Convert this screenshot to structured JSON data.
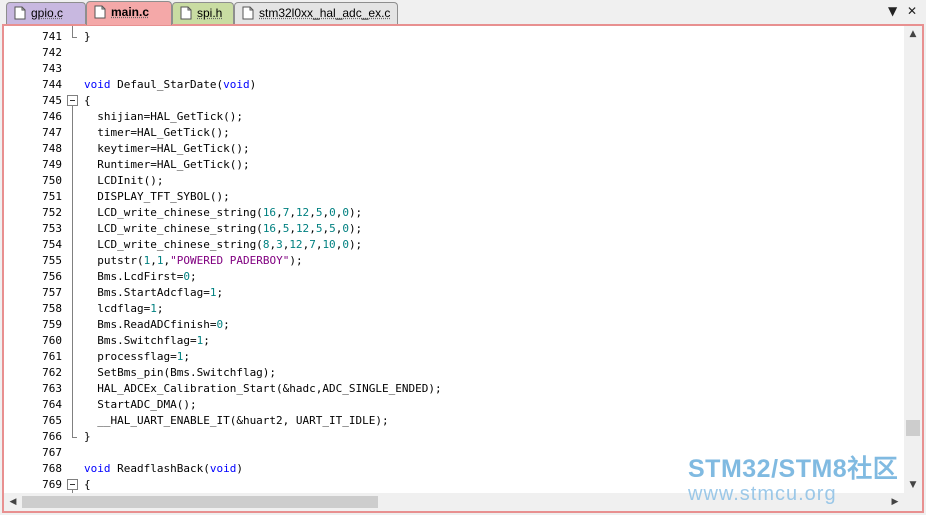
{
  "tabs": [
    {
      "label": "gpio.c",
      "active": false,
      "color": "#c8b8e0"
    },
    {
      "label": "main.c",
      "active": true,
      "color": "#f4a8a8"
    },
    {
      "label": "spi.h",
      "active": false,
      "color": "#c9dca2"
    },
    {
      "label": "stm32l0xx_hal_adc_ex.c",
      "active": false,
      "color": "#e4e4e4"
    }
  ],
  "tab_controls": {
    "dropdown_icon": "▼",
    "close_icon": "✕"
  },
  "scroll_icons": {
    "up": "▲",
    "down": "▼",
    "left": "◀",
    "right": "▶"
  },
  "editor": {
    "lines": [
      {
        "num": "741",
        "tokens": [
          [
            "}",
            "t"
          ]
        ]
      },
      {
        "num": "742",
        "tokens": []
      },
      {
        "num": "743",
        "tokens": []
      },
      {
        "num": "744",
        "tokens": [
          [
            "void",
            "kw"
          ],
          [
            " Defaul_StarDate(",
            "t"
          ],
          [
            "void",
            "kw"
          ],
          [
            ")",
            "t"
          ]
        ]
      },
      {
        "num": "745",
        "tokens": [
          [
            "{",
            "t"
          ]
        ]
      },
      {
        "num": "746",
        "tokens": [
          [
            "  shijian=HAL_GetTick();",
            "t"
          ]
        ]
      },
      {
        "num": "747",
        "tokens": [
          [
            "  timer=HAL_GetTick();",
            "t"
          ]
        ]
      },
      {
        "num": "748",
        "tokens": [
          [
            "  keytimer=HAL_GetTick();",
            "t"
          ]
        ]
      },
      {
        "num": "749",
        "tokens": [
          [
            "  Runtimer=HAL_GetTick();",
            "t"
          ]
        ]
      },
      {
        "num": "750",
        "tokens": [
          [
            "  LCDInit();",
            "t"
          ]
        ]
      },
      {
        "num": "751",
        "tokens": [
          [
            "  DISPLAY_TFT_SYBOL();",
            "t"
          ]
        ]
      },
      {
        "num": "752",
        "tokens": [
          [
            "  LCD_write_chinese_string(",
            "t"
          ],
          [
            "16",
            "num"
          ],
          [
            ",",
            "t"
          ],
          [
            "7",
            "num"
          ],
          [
            ",",
            "t"
          ],
          [
            "12",
            "num"
          ],
          [
            ",",
            "t"
          ],
          [
            "5",
            "num"
          ],
          [
            ",",
            "t"
          ],
          [
            "0",
            "num"
          ],
          [
            ",",
            "t"
          ],
          [
            "0",
            "num"
          ],
          [
            ");",
            "t"
          ]
        ]
      },
      {
        "num": "753",
        "tokens": [
          [
            "  LCD_write_chinese_string(",
            "t"
          ],
          [
            "16",
            "num"
          ],
          [
            ",",
            "t"
          ],
          [
            "5",
            "num"
          ],
          [
            ",",
            "t"
          ],
          [
            "12",
            "num"
          ],
          [
            ",",
            "t"
          ],
          [
            "5",
            "num"
          ],
          [
            ",",
            "t"
          ],
          [
            "5",
            "num"
          ],
          [
            ",",
            "t"
          ],
          [
            "0",
            "num"
          ],
          [
            ");",
            "t"
          ]
        ]
      },
      {
        "num": "754",
        "tokens": [
          [
            "  LCD_write_chinese_string(",
            "t"
          ],
          [
            "8",
            "num"
          ],
          [
            ",",
            "t"
          ],
          [
            "3",
            "num"
          ],
          [
            ",",
            "t"
          ],
          [
            "12",
            "num"
          ],
          [
            ",",
            "t"
          ],
          [
            "7",
            "num"
          ],
          [
            ",",
            "t"
          ],
          [
            "10",
            "num"
          ],
          [
            ",",
            "t"
          ],
          [
            "0",
            "num"
          ],
          [
            ");",
            "t"
          ]
        ]
      },
      {
        "num": "755",
        "tokens": [
          [
            "  putstr(",
            "t"
          ],
          [
            "1",
            "num"
          ],
          [
            ",",
            "t"
          ],
          [
            "1",
            "num"
          ],
          [
            ",",
            "t"
          ],
          [
            "\"POWERED PADERBOY\"",
            "str"
          ],
          [
            ");",
            "t"
          ]
        ]
      },
      {
        "num": "756",
        "tokens": [
          [
            "  Bms.LcdFirst=",
            "t"
          ],
          [
            "0",
            "num"
          ],
          [
            ";",
            "t"
          ]
        ]
      },
      {
        "num": "757",
        "tokens": [
          [
            "  Bms.StartAdcflag=",
            "t"
          ],
          [
            "1",
            "num"
          ],
          [
            ";",
            "t"
          ]
        ]
      },
      {
        "num": "758",
        "tokens": [
          [
            "  lcdflag=",
            "t"
          ],
          [
            "1",
            "num"
          ],
          [
            ";",
            "t"
          ]
        ]
      },
      {
        "num": "759",
        "tokens": [
          [
            "  Bms.ReadADCfinish=",
            "t"
          ],
          [
            "0",
            "num"
          ],
          [
            ";",
            "t"
          ]
        ]
      },
      {
        "num": "760",
        "tokens": [
          [
            "  Bms.Switchflag=",
            "t"
          ],
          [
            "1",
            "num"
          ],
          [
            ";",
            "t"
          ]
        ]
      },
      {
        "num": "761",
        "tokens": [
          [
            "  processflag=",
            "t"
          ],
          [
            "1",
            "num"
          ],
          [
            ";",
            "t"
          ]
        ]
      },
      {
        "num": "762",
        "tokens": [
          [
            "  SetBms_pin(Bms.Switchflag);",
            "t"
          ]
        ]
      },
      {
        "num": "763",
        "tokens": [
          [
            "  HAL_ADCEx_Calibration_Start(&hadc,ADC_SINGLE_ENDED);",
            "t"
          ]
        ]
      },
      {
        "num": "764",
        "tokens": [
          [
            "  StartADC_DMA();",
            "t"
          ]
        ]
      },
      {
        "num": "765",
        "tokens": [
          [
            "  __HAL_UART_ENABLE_IT(&huart2, UART_IT_IDLE);",
            "t"
          ]
        ]
      },
      {
        "num": "766",
        "tokens": [
          [
            "}",
            "t"
          ]
        ]
      },
      {
        "num": "767",
        "tokens": []
      },
      {
        "num": "768",
        "tokens": [
          [
            "void",
            "kw"
          ],
          [
            " ReadflashBack(",
            "t"
          ],
          [
            "void",
            "kw"
          ],
          [
            ")",
            "t"
          ]
        ]
      },
      {
        "num": "769",
        "tokens": [
          [
            "{",
            "t"
          ]
        ]
      }
    ]
  },
  "watermark": {
    "line1": "STM32/STM8社区",
    "line2": "www.stmcu.org"
  }
}
